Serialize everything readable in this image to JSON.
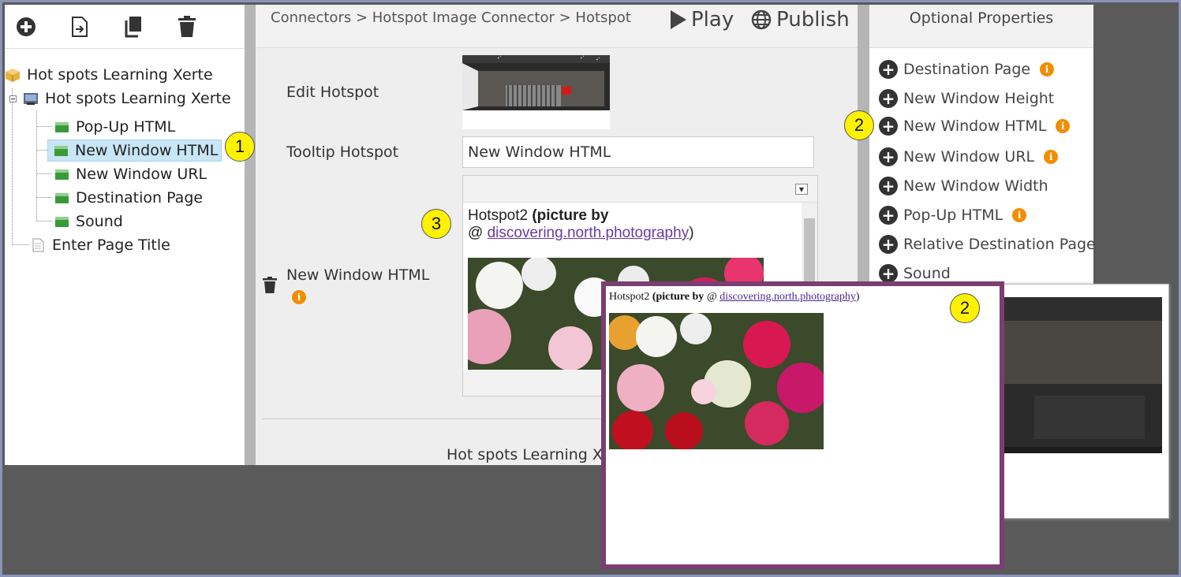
{
  "toolbar": {
    "icons": [
      "add-icon",
      "import-icon",
      "copy-icon",
      "delete-icon"
    ]
  },
  "tree": {
    "root": "Hot spots Learning Xerte",
    "page": "Hot spots Learning Xerte",
    "children": [
      "Pop-Up HTML",
      "New Window HTML",
      "New Window URL",
      "Destination Page",
      "Sound"
    ],
    "last": "Enter Page Title",
    "selected": "New Window HTML"
  },
  "badges": {
    "one": "1",
    "two": "2",
    "three": "3"
  },
  "header": {
    "breadcrumb": "Connectors > Hotspot Image Connector > Hotspot",
    "play": "Play",
    "publish": "Publish"
  },
  "form": {
    "edit_hotspot_label": "Edit Hotspot",
    "tooltip_label": "Tooltip Hotspot",
    "tooltip_value": "New Window HTML",
    "html_label": "New Window HTML",
    "editor_text_1": "Hotspot2 ",
    "editor_bold": "(picture by",
    "editor_at": "@ ",
    "editor_link": "discovering.north.photography",
    "editor_close": ")",
    "footer": "Hot spots Learning Xe"
  },
  "optional": {
    "title": "Optional Properties",
    "items": [
      {
        "label": "Destination Page",
        "info": true
      },
      {
        "label": "New Window Height",
        "info": false
      },
      {
        "label": "New Window HTML",
        "info": true
      },
      {
        "label": "New Window URL",
        "info": true
      },
      {
        "label": "New Window Width",
        "info": false
      },
      {
        "label": "Pop-Up HTML",
        "info": true
      },
      {
        "label": "Relative Destination Page",
        "info": false
      },
      {
        "label": "Sound",
        "info": false
      }
    ]
  },
  "popup": {
    "text_1": "Hotspot2 ",
    "bold": "(picture by",
    "at": " @ ",
    "link": "discovering.north.photography",
    "close": ")"
  },
  "colors": {
    "selection": "#c8e6f5",
    "badge": "#fff200",
    "info": "#f28c00",
    "popup_border": "#7a3e72",
    "link": "#6a3aa0"
  }
}
